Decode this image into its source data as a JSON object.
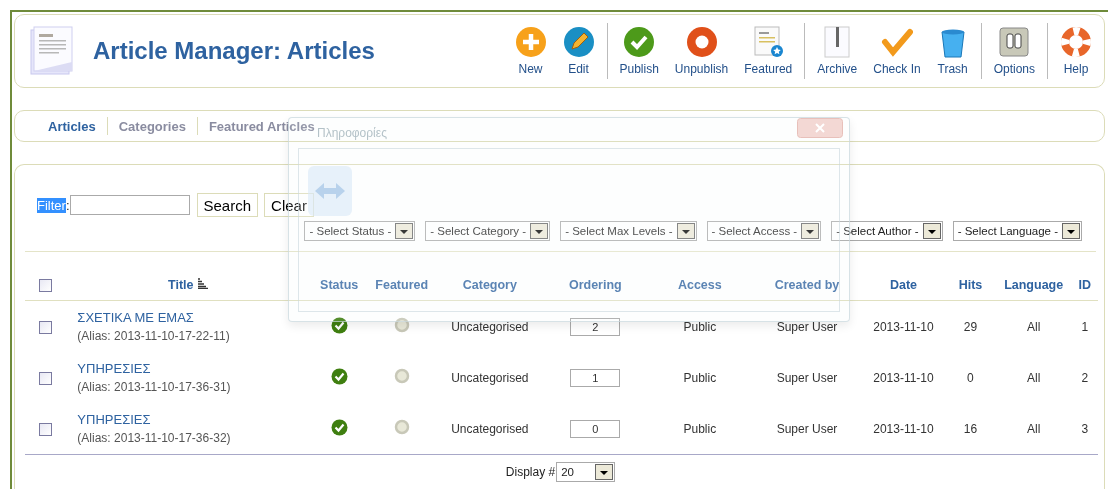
{
  "header": {
    "title": "Article Manager: Articles"
  },
  "toolbar": [
    [
      {
        "kind": "new",
        "label": "New"
      },
      {
        "kind": "edit",
        "label": "Edit"
      }
    ],
    [
      {
        "kind": "publish",
        "label": "Publish"
      },
      {
        "kind": "unpublish",
        "label": "Unpublish"
      },
      {
        "kind": "featured",
        "label": "Featured"
      }
    ],
    [
      {
        "kind": "archive",
        "label": "Archive"
      },
      {
        "kind": "checkin",
        "label": "Check In"
      },
      {
        "kind": "trash",
        "label": "Trash"
      }
    ],
    [
      {
        "kind": "options",
        "label": "Options"
      }
    ],
    [
      {
        "kind": "help",
        "label": "Help"
      }
    ]
  ],
  "tabs": [
    {
      "label": "Articles",
      "selected": true
    },
    {
      "label": "Categories",
      "selected": false
    },
    {
      "label": "Featured Articles",
      "selected": false
    }
  ],
  "filter": {
    "label_parts": [
      {
        "text": "Filter",
        "highlighted": true
      },
      {
        "text": ":",
        "highlighted": false
      }
    ],
    "buttons": [
      "Search",
      "Clear"
    ]
  },
  "selects": [
    "- Select Status -",
    "- Select Category -",
    "- Select Max Levels -",
    "- Select Access -",
    "- Select Author -",
    "- Select Language -"
  ],
  "table": {
    "select_all_checked": false,
    "columns": [
      {
        "label": "Title",
        "sorted": true
      },
      {
        "label": "Status",
        "sorted": false
      },
      {
        "label": "Featured",
        "sorted": false
      },
      {
        "label": "Category",
        "sorted": false
      },
      {
        "label": "Ordering",
        "sorted": false
      },
      {
        "label": "Access",
        "sorted": false
      },
      {
        "label": "Created by",
        "sorted": false
      },
      {
        "label": "Date",
        "sorted": false
      },
      {
        "label": "Hits",
        "sorted": false
      },
      {
        "label": "Language",
        "sorted": false
      },
      {
        "label": "ID",
        "sorted": false
      }
    ],
    "rows": [
      {
        "checked": false,
        "title": "ΣΧΕΤΙΚΑ ΜΕ ΕΜΑΣ",
        "alias": "(Alias: 2013-11-10-17-22-11)",
        "published": true,
        "featured": false,
        "category": "Uncategorised",
        "ordering": "2",
        "access": "Public",
        "created_by": "Super User",
        "date": "2013-11-10",
        "hits": "29",
        "language": "All",
        "id": "1"
      },
      {
        "checked": false,
        "title": "ΥΠΗΡΕΣΙΕΣ",
        "alias": "(Alias: 2013-11-10-17-36-31)",
        "published": true,
        "featured": false,
        "category": "Uncategorised",
        "ordering": "1",
        "access": "Public",
        "created_by": "Super User",
        "date": "2013-11-10",
        "hits": "0",
        "language": "All",
        "id": "2"
      },
      {
        "checked": false,
        "title": "ΥΠΗΡΕΣΙΕΣ",
        "alias": "(Alias: 2013-11-10-17-36-32)",
        "published": true,
        "featured": false,
        "category": "Uncategorised",
        "ordering": "0",
        "access": "Public",
        "created_by": "Super User",
        "date": "2013-11-10",
        "hits": "16",
        "language": "All",
        "id": "3"
      }
    ]
  },
  "display": {
    "label": "Display #",
    "value": "20"
  },
  "faded_dialog": {
    "title": "Πληροφορίες"
  }
}
